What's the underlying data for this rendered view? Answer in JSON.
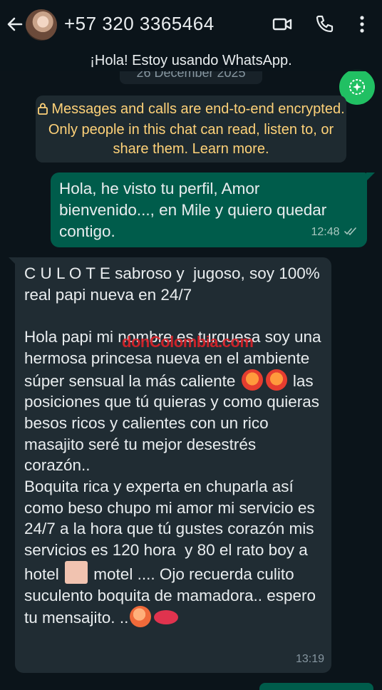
{
  "header": {
    "contact": "+57 320 3365464",
    "status": "¡Hola! Estoy usando WhatsApp.",
    "icons": [
      "back-arrow-icon",
      "video-call-icon",
      "phone-icon",
      "more-menu-icon"
    ]
  },
  "date_label": "26 December 2025",
  "encryption_notice": "Messages and calls are end-to-end encrypted. Only people in this chat can read, listen to, or share them. Learn more.",
  "messages": [
    {
      "direction": "outgoing",
      "text": "Hola, he visto tu perfil, Amor bienvenido..., en Mile y quiero quedar contigo.",
      "time": "12:48",
      "status": "read"
    },
    {
      "direction": "incoming",
      "paragraph1": "C U L O T E sabroso y  jugoso, soy 100% real papi nueva en 24/7",
      "paragraph2a": "Hola papi mi nombre es turquesa soy una hermosa princesa nueva en el ambiente súper sensual la más caliente ",
      "paragraph2b": " las posiciones que tú quieras y como quieras besos ricos y calientes con un rico masajito seré tu mejor desestrés corazón..",
      "paragraph3a": "Boquita rica y experta en chuparla así como beso chupo mi amor mi servicio es 24/7 a la hora que tú gustes corazón mis servicios es 120 hora  y 80 el rato boy a hotel ",
      "paragraph3b": " motel .... Ojo recuerda culito suculento boquita de mamadora.. espero tu mensajito. ..",
      "time": "13:19"
    }
  ],
  "watermark": "donColombia.com",
  "colors": {
    "background": "#0b141a",
    "outgoing_bubble": "#005c4b",
    "incoming_bubble": "#202c33",
    "encryption_text": "#ffd279",
    "fab": "#21c063"
  }
}
